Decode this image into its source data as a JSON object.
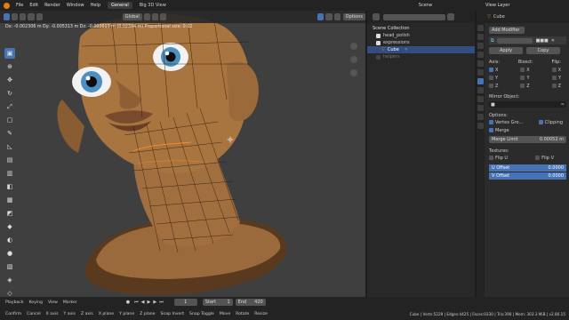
{
  "menu": {
    "items": [
      "File",
      "Edit",
      "Render",
      "Window",
      "Help"
    ],
    "workspaces": [
      "General",
      "Big 3D View"
    ],
    "scene_label": "Scene",
    "view_layer_label": "View Layer"
  },
  "viewport": {
    "orientation": "Global",
    "options_label": "Options",
    "status_text": "Dx: -0.002306 m   Dy: -0.005313 m   Dz: -0.003613 m (0.02394 m)   Proportional size: 0.02"
  },
  "outliner": {
    "rows": [
      {
        "label": "Scene Collection"
      },
      {
        "label": "head_polish"
      },
      {
        "label": "expressions"
      },
      {
        "label": "Cube"
      },
      {
        "label": "helpers"
      }
    ]
  },
  "properties": {
    "object_name": "Cube",
    "add_modifier": "Add Modifier",
    "apply_label": "Apply",
    "copy_label": "Copy",
    "axis_header": "Axis:",
    "bisect_header": "Bisect:",
    "flip_header": "Flip:",
    "axes": [
      "X",
      "Y",
      "Z"
    ],
    "mirror_object_label": "Mirror Object:",
    "options_label": "Options:",
    "vertex_groups_label": "Vertex Gro...",
    "clipping_label": "Clipping",
    "merge_label": "Merge",
    "merge_limit_label": "Merge Limit",
    "merge_limit_value": "0.00052 m",
    "textures_label": "Textures:",
    "flip_u_label": "Flip U",
    "flip_v_label": "Flip V",
    "u_offset_label": "U Offset",
    "u_offset_value": "0.0000",
    "v_offset_label": "V Offset",
    "v_offset_value": "0.0000"
  },
  "timeline": {
    "playback_label": "Playback",
    "keying_label": "Keying",
    "view_label": "View",
    "marker_label": "Marker",
    "current_frame": "1",
    "start_label": "Start",
    "start_value": "1",
    "end_label": "End",
    "end_value": "420"
  },
  "statusbar": {
    "hints": [
      "Confirm",
      "Cancel",
      "X axis",
      "Y axis",
      "Z axis",
      "X plane",
      "Y plane",
      "Z plane",
      "Snap Invert",
      "Snap Toggle",
      "Move",
      "Rotate",
      "Resize"
    ],
    "stats": "Cube | Verts:5229 | Edges:4425 | Faces:0330 | Tris:390 | Mem: 303.3 MiB | v2.80.15"
  }
}
